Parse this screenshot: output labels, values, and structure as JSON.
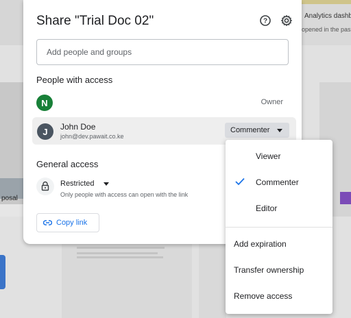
{
  "background": {
    "left_card_label": "posal",
    "right_card_title": "Analytics dashb",
    "right_card_subtitle": "opened in the pas"
  },
  "dialog": {
    "title": "Share \"Trial Doc 02\"",
    "add_placeholder": "Add people and groups",
    "people_heading": "People with access",
    "owner": {
      "avatar_letter": "N",
      "avatar_color": "#188038",
      "role": "Owner"
    },
    "john": {
      "avatar_letter": "J",
      "avatar_color": "#4a5561",
      "name": "John Doe",
      "email": "john@dev.pawait.co.ke",
      "role": "Commenter"
    },
    "general_heading": "General access",
    "restriction": "Restricted",
    "restriction_desc": "Only people with access can open with the link",
    "copy_link": "Copy link"
  },
  "role_menu": {
    "roles": [
      {
        "label": "Viewer",
        "checked": false
      },
      {
        "label": "Commenter",
        "checked": true
      },
      {
        "label": "Editor",
        "checked": false
      }
    ],
    "actions": [
      "Add expiration",
      "Transfer ownership",
      "Remove access"
    ]
  },
  "colors": {
    "accent": "#1a73e8"
  }
}
